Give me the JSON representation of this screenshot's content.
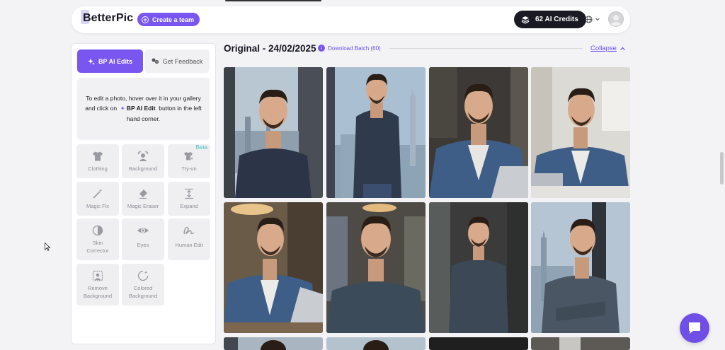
{
  "header": {
    "logo": "BetterPic",
    "create_team": "Create a team",
    "credits": "62 AI Credits"
  },
  "sidebar": {
    "tabs": [
      {
        "label": "BP AI Edits",
        "active": true
      },
      {
        "label": "Get Feedback",
        "active": false
      }
    ],
    "info": {
      "line1": "To edit a photo, hover over it in your gallery",
      "line2_pre": "and click on",
      "keyword": "BP AI Edit",
      "line2_post": "button in the left",
      "line3": "hand corner."
    },
    "tools": [
      {
        "label": "Clothing",
        "icon": "shirt-icon"
      },
      {
        "label": "Background",
        "icon": "background-icon"
      },
      {
        "label": "Try-on",
        "icon": "try-on-icon",
        "badge": "Beta"
      },
      {
        "label": "Magic Fix",
        "icon": "magic-wand-icon"
      },
      {
        "label": "Magic Eraser",
        "icon": "eraser-icon"
      },
      {
        "label": "Expand",
        "icon": "expand-icon"
      },
      {
        "label_line1": "Skin",
        "label_line2": "Corrector",
        "icon": "skin-icon"
      },
      {
        "label": "Eyes",
        "icon": "eye-icon"
      },
      {
        "label": "Human Edit",
        "icon": "human-edit-icon"
      },
      {
        "label_line1": "Remove",
        "label_line2": "Background",
        "icon": "remove-bg-icon"
      },
      {
        "label_line1": "Colored",
        "label_line2": "Background",
        "icon": "colored-bg-icon"
      }
    ]
  },
  "main": {
    "title": "Original - 24/02/2025",
    "download": "Download Batch (60)",
    "collapse": "Collapse"
  },
  "colors": {
    "accent": "#7a56f0",
    "dark": "#1a1a24",
    "beta": "#49c1c1"
  }
}
